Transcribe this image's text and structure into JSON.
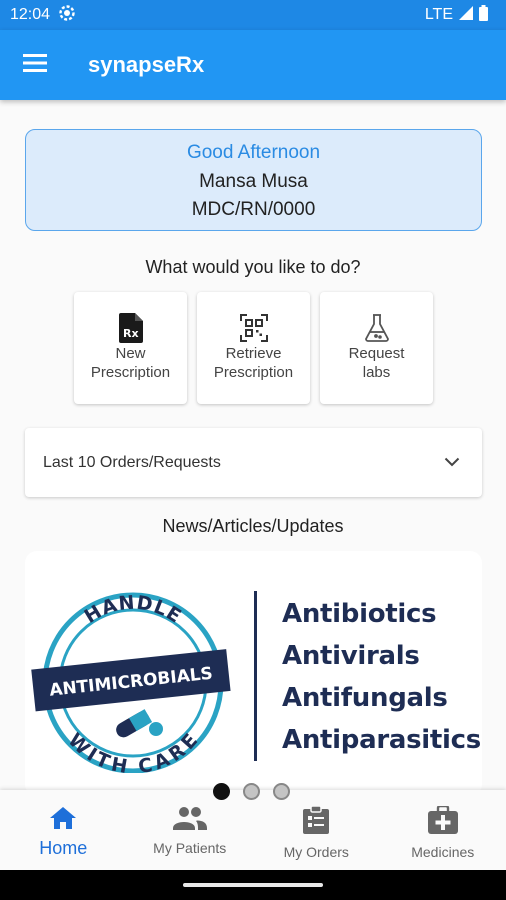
{
  "status_bar": {
    "time": "12:04",
    "network": "LTE"
  },
  "app_bar": {
    "title": "synapseRx"
  },
  "greeting_card": {
    "greeting": "Good Afternoon",
    "name": "Mansa Musa",
    "id": "MDC/RN/0000"
  },
  "actions": {
    "question": "What would you like to do?",
    "items": [
      {
        "label": "New\nPrescription",
        "icon": "prescription-icon"
      },
      {
        "label": "Retrieve\nPrescription",
        "icon": "qr-code-icon"
      },
      {
        "label": "Request\nlabs",
        "icon": "flask-icon"
      }
    ]
  },
  "orders": {
    "label": "Last 10 Orders/Requests"
  },
  "news": {
    "title": "News/Articles/Updates",
    "banner": {
      "badge_top": "HANDLE",
      "badge_ribbon": "ANTIMICROBIALS",
      "badge_bottom": "WITH CARE",
      "items": [
        "Antibiotics",
        "Antivirals",
        "Antifungals",
        "Antiparasitics"
      ]
    },
    "carousel": {
      "count": 3,
      "active_index": 0
    }
  },
  "bottom_nav": {
    "items": [
      {
        "label": "Home",
        "icon": "home-icon"
      },
      {
        "label": "My Patients",
        "icon": "people-icon"
      },
      {
        "label": "My Orders",
        "icon": "clipboard-icon"
      },
      {
        "label": "Medicines",
        "icon": "medical-bag-icon"
      }
    ],
    "active_index": 0
  },
  "colors": {
    "primary": "#2196f3",
    "status_bar": "#1e88e5",
    "card_bg": "#dcebfb",
    "banner_navy": "#1e2d54",
    "banner_teal": "#2aa3c4",
    "nav_active": "#1e6fd9"
  }
}
